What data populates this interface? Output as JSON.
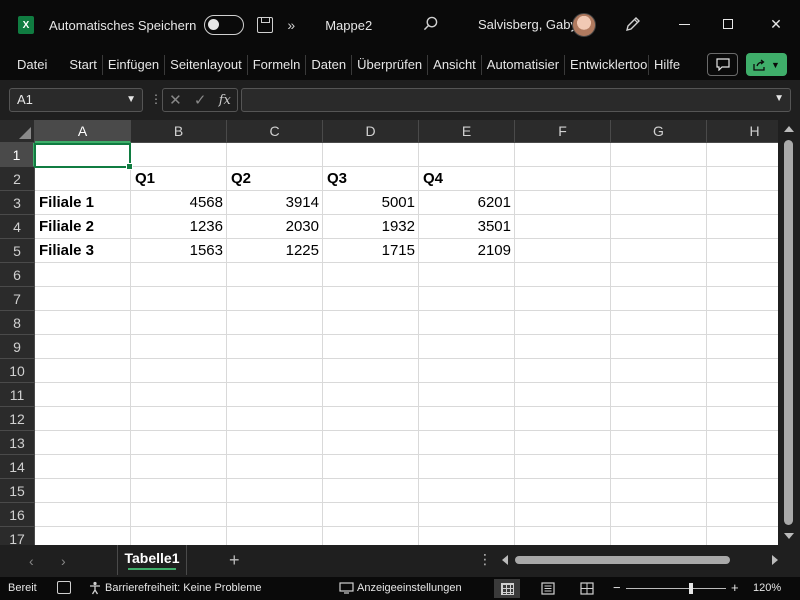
{
  "title_bar": {
    "app_icon": "excel-icon",
    "app_letter": "X",
    "autosave_label": "Automatisches Speichern",
    "more_glyph": "»",
    "document_title": "Mappe2",
    "user_name": "Salvisberg, Gaby",
    "window_controls": [
      "minimize-icon",
      "maximize-icon",
      "close-icon"
    ],
    "close_glyph": "✕"
  },
  "ribbon": {
    "tabs": [
      "Datei",
      "Start",
      "Einfügen",
      "Seitenlayout",
      "Formeln",
      "Daten",
      "Überprüfen",
      "Ansicht",
      "Automatisier",
      "Entwicklertools",
      "Hilfe"
    ]
  },
  "formula_bar": {
    "name_box": "A1",
    "fx_glyph": "fx",
    "cancel_glyph": "✕",
    "enter_glyph": "✓",
    "formula_value": ""
  },
  "grid": {
    "columns": [
      "A",
      "B",
      "C",
      "D",
      "E",
      "F",
      "G",
      "H"
    ],
    "rows": [
      "1",
      "2",
      "3",
      "4",
      "5",
      "6",
      "7",
      "8",
      "9",
      "10",
      "11",
      "12",
      "13",
      "14",
      "15",
      "16",
      "17"
    ],
    "selected_cell": "A1",
    "cells": [
      {
        "ref": "B2",
        "value": "Q1",
        "bold": true
      },
      {
        "ref": "C2",
        "value": "Q2",
        "bold": true
      },
      {
        "ref": "D2",
        "value": "Q3",
        "bold": true
      },
      {
        "ref": "E2",
        "value": "Q4",
        "bold": true
      },
      {
        "ref": "A3",
        "value": "Filiale 1",
        "bold": true
      },
      {
        "ref": "B3",
        "value": "4568",
        "num": true
      },
      {
        "ref": "C3",
        "value": "3914",
        "num": true
      },
      {
        "ref": "D3",
        "value": "5001",
        "num": true
      },
      {
        "ref": "E3",
        "value": "6201",
        "num": true
      },
      {
        "ref": "A4",
        "value": "Filiale 2",
        "bold": true
      },
      {
        "ref": "B4",
        "value": "1236",
        "num": true
      },
      {
        "ref": "C4",
        "value": "2030",
        "num": true
      },
      {
        "ref": "D4",
        "value": "1932",
        "num": true
      },
      {
        "ref": "E4",
        "value": "3501",
        "num": true
      },
      {
        "ref": "A5",
        "value": "Filiale 3",
        "bold": true
      },
      {
        "ref": "B5",
        "value": "1563",
        "num": true
      },
      {
        "ref": "C5",
        "value": "1225",
        "num": true
      },
      {
        "ref": "D5",
        "value": "1715",
        "num": true
      },
      {
        "ref": "E5",
        "value": "2109",
        "num": true
      }
    ]
  },
  "sheets": {
    "active_tab": "Tabelle1",
    "prev_glyph": "‹",
    "next_glyph": "›",
    "add_glyph": "+",
    "menu_glyph": "⋮"
  },
  "status_bar": {
    "ready": "Bereit",
    "accessibility": "Barrierefreiheit: Keine Probleme",
    "display_settings": "Anzeigeeinstellungen",
    "zoom_minus": "−",
    "zoom_plus": "+",
    "zoom_level": "120%",
    "zoom_slider_fraction": 0.65
  },
  "colors": {
    "accent_green": "#107c41",
    "share_green": "#3fae6a",
    "chrome_dark": "#0a0a0a"
  }
}
